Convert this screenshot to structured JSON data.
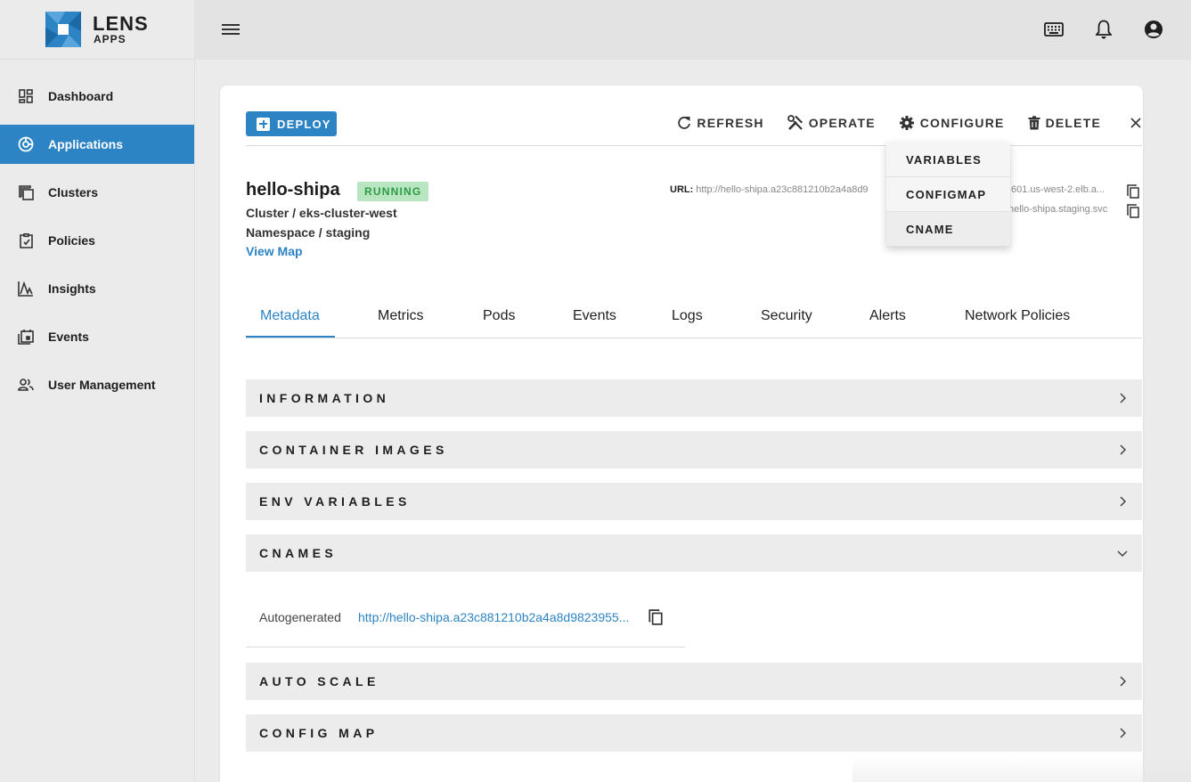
{
  "brand": {
    "name": "LENS",
    "sub": "APPS"
  },
  "sidebar": {
    "items": [
      {
        "label": "Dashboard",
        "icon": "dashboard-icon"
      },
      {
        "label": "Applications",
        "icon": "applications-icon",
        "active": true
      },
      {
        "label": "Clusters",
        "icon": "clusters-icon"
      },
      {
        "label": "Policies",
        "icon": "policies-icon"
      },
      {
        "label": "Insights",
        "icon": "insights-icon"
      },
      {
        "label": "Events",
        "icon": "events-icon"
      },
      {
        "label": "User Management",
        "icon": "users-icon"
      }
    ]
  },
  "topbar": {
    "icons": [
      "menu-icon",
      "keyboard-icon",
      "bell-icon",
      "account-icon"
    ]
  },
  "toolbar": {
    "deploy": "DEPLOY",
    "refresh": "REFRESH",
    "operate": "OPERATE",
    "configure": "CONFIGURE",
    "delete": "DELETE"
  },
  "configure_menu": [
    "VARIABLES",
    "CONFIGMAP",
    "CNAME"
  ],
  "app": {
    "name": "hello-shipa",
    "status": "RUNNING",
    "cluster": "Cluster / eks-cluster-west",
    "namespace": "Namespace / staging",
    "view_map": "View Map",
    "url_label": "URL:",
    "url_value": "http://hello-shipa.a23c881210b2a4a8d9",
    "url_tail": "601.us-west-2.elb.a...",
    "internal_tail": "hello-shipa.staging.svc"
  },
  "tabs": [
    "Metadata",
    "Metrics",
    "Pods",
    "Events",
    "Logs",
    "Security",
    "Alerts",
    "Network Policies"
  ],
  "sections": {
    "information": "INFORMATION",
    "container_images": "CONTAINER IMAGES",
    "env_variables": "ENV VARIABLES",
    "cnames": "CNAMES",
    "auto_scale": "AUTO SCALE",
    "config_map": "CONFIG MAP"
  },
  "cnames": {
    "label": "Autogenerated",
    "value": "http://hello-shipa.a23c881210b2a4a8d9823955..."
  },
  "colors": {
    "accent": "#2d84c4",
    "running_bg": "#b8e6c0",
    "running_text": "#2e9b47"
  }
}
